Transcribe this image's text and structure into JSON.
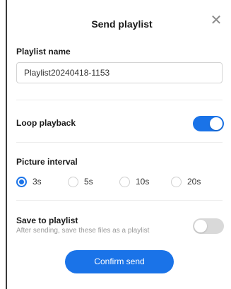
{
  "dialog": {
    "title": "Send playlist",
    "close_icon": "close-icon",
    "accent_color": "#1a73e8"
  },
  "playlist_name": {
    "label": "Playlist name",
    "value": "Playlist20240418-1153"
  },
  "loop_playback": {
    "label": "Loop playback",
    "enabled": true
  },
  "picture_interval": {
    "label": "Picture interval",
    "selected": "3s",
    "options": [
      "3s",
      "5s",
      "10s",
      "20s"
    ]
  },
  "save_to_playlist": {
    "label": "Save to playlist",
    "hint": "After sending, save these files as a playlist",
    "enabled": false
  },
  "actions": {
    "confirm_label": "Confirm send"
  }
}
